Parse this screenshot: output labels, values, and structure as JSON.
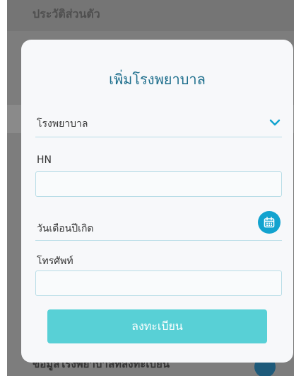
{
  "background": {
    "header_title": "ประวัติส่วนตัว",
    "footer_text": "ข้อมูลโรงพยาบาลที่ลงทะเบียน"
  },
  "modal": {
    "title": "เพิ่มโรงพยาบาล",
    "hospital_select": {
      "label": "โรงพยาบาล",
      "icon": "chevron-down-icon"
    },
    "hn": {
      "label": "HN",
      "value": "",
      "placeholder": ""
    },
    "birth_date": {
      "label": "วันเดือนปีเกิด",
      "icon": "calendar-icon"
    },
    "phone": {
      "label": "โทรศัพท์",
      "value": "",
      "placeholder": ""
    },
    "submit_label": "ลงทะเบียน"
  },
  "colors": {
    "accent": "#13a3cf",
    "title": "#1d6e8c",
    "button": "#58d0d6",
    "border": "#b9dde7"
  }
}
